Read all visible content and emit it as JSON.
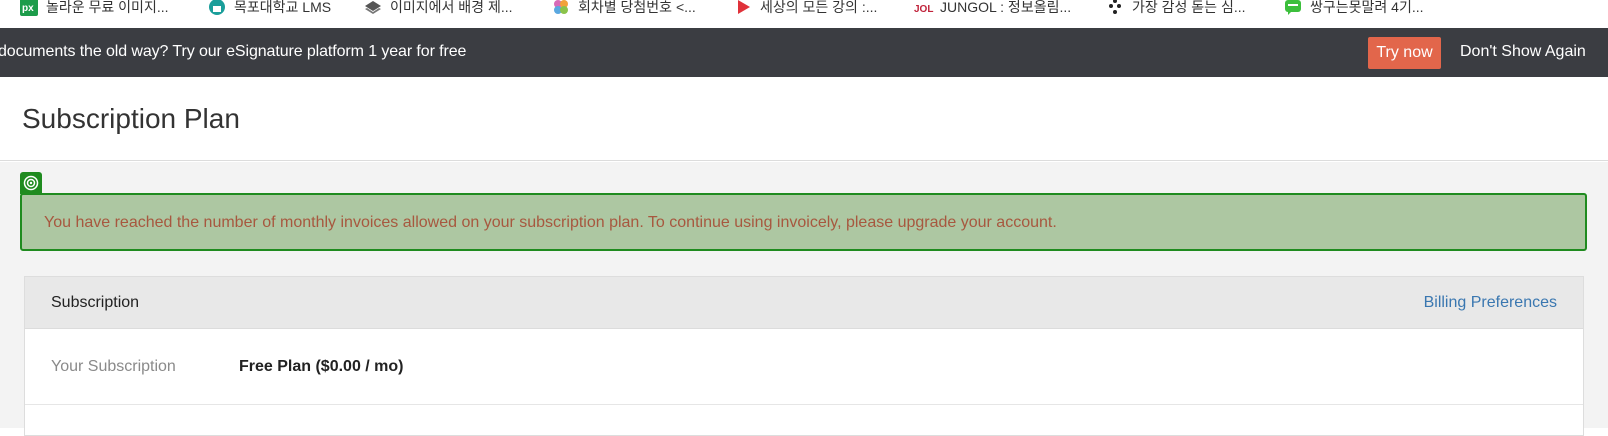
{
  "bookmarks": [
    {
      "label": "놀라운 무료 이미지...",
      "icon": "px-icon",
      "color": "#1c9c4a"
    },
    {
      "label": "목포대학교 LMS",
      "icon": "lms-icon",
      "color": "#1a9e9a"
    },
    {
      "label": "이미지에서 배경 제...",
      "icon": "layers-icon",
      "color": "#555555"
    },
    {
      "label": "회차별 당첨번호 <...",
      "icon": "pinwheel-icon",
      "color": "#d86ab8"
    },
    {
      "label": "세상의 모든 강의 :...",
      "icon": "play-icon",
      "color": "#e0323a"
    },
    {
      "label": "JUNGOL : 정보올림...",
      "icon": "jol-icon",
      "color": "#c0223a"
    },
    {
      "label": "가장 감성 돋는 심...",
      "icon": "dots-icon",
      "color": "#222222"
    },
    {
      "label": "쌍구는못말려 4기...",
      "icon": "chat-icon",
      "color": "#3cbf3c"
    }
  ],
  "promo": {
    "text": "documents the old way? Try our eSignature platform 1 year for free",
    "try_now": "Try now",
    "dont_show": "Don't Show Again"
  },
  "page": {
    "title": "Subscription Plan"
  },
  "alert": {
    "message": "You have reached the number of monthly invoices allowed on your subscription plan. To continue using invoicely, please upgrade your account.",
    "icon": "target-icon"
  },
  "subscription": {
    "heading": "Subscription",
    "billing_link": "Billing Preferences",
    "rows": [
      {
        "label": "Your Subscription",
        "value": "Free Plan ($0.00 / mo)"
      }
    ]
  },
  "colors": {
    "promo_bg": "#3b3d42",
    "try_now_bg": "#e2664b",
    "alert_bg": "#adc7a2",
    "alert_border": "#1f8b1f",
    "alert_text": "#a7583f",
    "link": "#3a77b0"
  }
}
